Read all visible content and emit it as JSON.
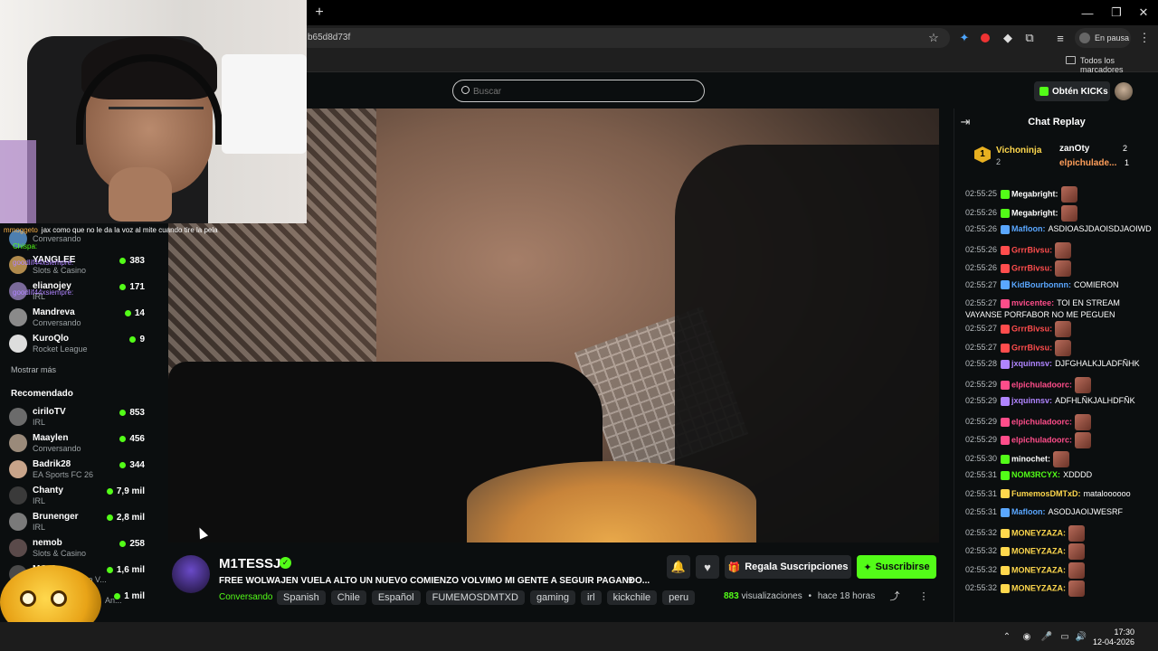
{
  "browser": {
    "url_fragment": "b65d8d73f",
    "profile_label": "En pausa",
    "bookmarks_label": "Todos los marcadores"
  },
  "topnav": {
    "search_placeholder": "Buscar",
    "kicks_label": "Obtén KICKs"
  },
  "sidebar": {
    "overlay_chat": [
      {
        "user": "mmoggeto",
        "text": "jax como que no le da la voz al mite cuando tire la pela",
        "color": "#ffb347"
      },
      {
        "user": "Chispa:",
        "text": "",
        "color": "#53fc18"
      },
      {
        "user": "goodlif44xsiempre:",
        "text": "",
        "color": "#b085ff"
      },
      {
        "user": "goodlif44xsiempre:",
        "text": "",
        "color": "#b085ff"
      }
    ],
    "following": [
      {
        "name": "Conversando",
        "category": "",
        "viewers": ""
      },
      {
        "name": "YANGLEE",
        "category": "Slots & Casino",
        "viewers": "383"
      },
      {
        "name": "elianojey",
        "category": "IRL",
        "viewers": "171"
      },
      {
        "name": "Mandreva",
        "category": "Conversando",
        "viewers": "14"
      },
      {
        "name": "KuroQlo",
        "category": "Rocket League",
        "viewers": "9"
      }
    ],
    "show_more": "Mostrar más",
    "recommended_title": "Recomendado",
    "recommended": [
      {
        "name": "ciriloTV",
        "category": "IRL",
        "viewers": "853"
      },
      {
        "name": "Maaylen",
        "category": "Conversando",
        "viewers": "456"
      },
      {
        "name": "Badrik28",
        "category": "EA Sports FC 26",
        "viewers": "344"
      },
      {
        "name": "Chanty",
        "category": "IRL",
        "viewers": "7,9 mil"
      },
      {
        "name": "Brunenger",
        "category": "IRL",
        "viewers": "2,8 mil"
      },
      {
        "name": "nemob",
        "category": "Slots & Casino",
        "viewers": "258"
      },
      {
        "name": "MC•G",
        "category": "Auto V...",
        "viewers": "1,6 mil"
      },
      {
        "name": "",
        "category": "An...",
        "viewers": "1 mil"
      }
    ]
  },
  "stream": {
    "channel": "M1TESSJ",
    "title": "FREE WOLWAJEN VUELA ALTO UN NUEVO COMIENZO VOLVIMO MI GENTE A SEGUIR PAGANDO...",
    "category": "Conversando",
    "tags": [
      "Spanish",
      "Chile",
      "Español",
      "FUMEMOSDMTXD",
      "gaming",
      "irl",
      "kickchile",
      "peru"
    ],
    "views": "883",
    "views_label": "visualizaciones",
    "time_ago": "hace 18 horas",
    "gift_label": "Regala Suscripciones",
    "subscribe_label": "Suscribirse"
  },
  "chat": {
    "title": "Chat Replay",
    "leaderboard": {
      "rank": "1",
      "first": {
        "name": "Vichoninja",
        "count": "2"
      },
      "second": {
        "name": "zanOty",
        "count": "2"
      },
      "third": {
        "name": "elpichulade...",
        "count": "1"
      }
    },
    "messages": [
      {
        "time": "02:55:25",
        "user": "Megabright:",
        "color": "#ffffff",
        "text": "",
        "emote": true
      },
      {
        "time": "02:55:26",
        "user": "Megabright:",
        "color": "#ffffff",
        "text": "",
        "emote": true
      },
      {
        "time": "02:55:26",
        "user": "Mafloon:",
        "color": "#5aa7ff",
        "text": "ASDIOASJDAOISDJAOIWD",
        "emote": false
      },
      {
        "time": "02:55:26",
        "user": "GrrrBivsu:",
        "color": "#ff4d4d",
        "text": "",
        "emote": true
      },
      {
        "time": "02:55:26",
        "user": "GrrrBivsu:",
        "color": "#ff4d4d",
        "text": "",
        "emote": true
      },
      {
        "time": "02:55:27",
        "user": "KidBourbonnn:",
        "color": "#5aa7ff",
        "text": "COMIERON",
        "emote": false
      },
      {
        "time": "02:55:27",
        "user": "mvicentee:",
        "color": "#ff4d8a",
        "text": "TOI EN STREAM VAYANSE PORFABOR NO ME PEGUEN",
        "emote": false
      },
      {
        "time": "02:55:27",
        "user": "GrrrBivsu:",
        "color": "#ff4d4d",
        "text": "",
        "emote": true
      },
      {
        "time": "02:55:27",
        "user": "GrrrBivsu:",
        "color": "#ff4d4d",
        "text": "",
        "emote": true
      },
      {
        "time": "02:55:28",
        "user": "jxquinnsv:",
        "color": "#b085ff",
        "text": "DJFGHALKJLADFÑHK",
        "emote": false
      },
      {
        "time": "02:55:29",
        "user": "elpichuladoorc:",
        "color": "#ff4d8a",
        "text": "",
        "emote": true
      },
      {
        "time": "02:55:29",
        "user": "jxquinnsv:",
        "color": "#b085ff",
        "text": "ADFHLÑKJALHDFÑK",
        "emote": false
      },
      {
        "time": "02:55:29",
        "user": "elpichuladoorc:",
        "color": "#ff4d8a",
        "text": "",
        "emote": true
      },
      {
        "time": "02:55:29",
        "user": "elpichuladoorc:",
        "color": "#ff4d8a",
        "text": "",
        "emote": true
      },
      {
        "time": "02:55:30",
        "user": "minochet:",
        "color": "#ffffff",
        "text": "",
        "emote": true
      },
      {
        "time": "02:55:31",
        "user": "NOM3RCYX:",
        "color": "#53fc18",
        "text": "XDDDD",
        "emote": false
      },
      {
        "time": "02:55:31",
        "user": "FumemosDMTxD:",
        "color": "#ffd84d",
        "text": "mataloooooo",
        "emote": false
      },
      {
        "time": "02:55:31",
        "user": "Mafloon:",
        "color": "#5aa7ff",
        "text": "ASODJAOIJWESRF",
        "emote": false
      },
      {
        "time": "02:55:32",
        "user": "MONEYZAZA:",
        "color": "#ffd84d",
        "text": "",
        "emote": true
      },
      {
        "time": "02:55:32",
        "user": "MONEYZAZA:",
        "color": "#ffd84d",
        "text": "",
        "emote": true
      },
      {
        "time": "02:55:32",
        "user": "MONEYZAZA:",
        "color": "#ffd84d",
        "text": "",
        "emote": true
      },
      {
        "time": "02:55:32",
        "user": "MONEYZAZA:",
        "color": "#ffd84d",
        "text": "",
        "emote": true
      }
    ]
  },
  "taskbar": {
    "time": "17:30",
    "date": "12-04-2026"
  },
  "colors": {
    "accent": "#53fc18",
    "bg": "#0b0e0f"
  }
}
